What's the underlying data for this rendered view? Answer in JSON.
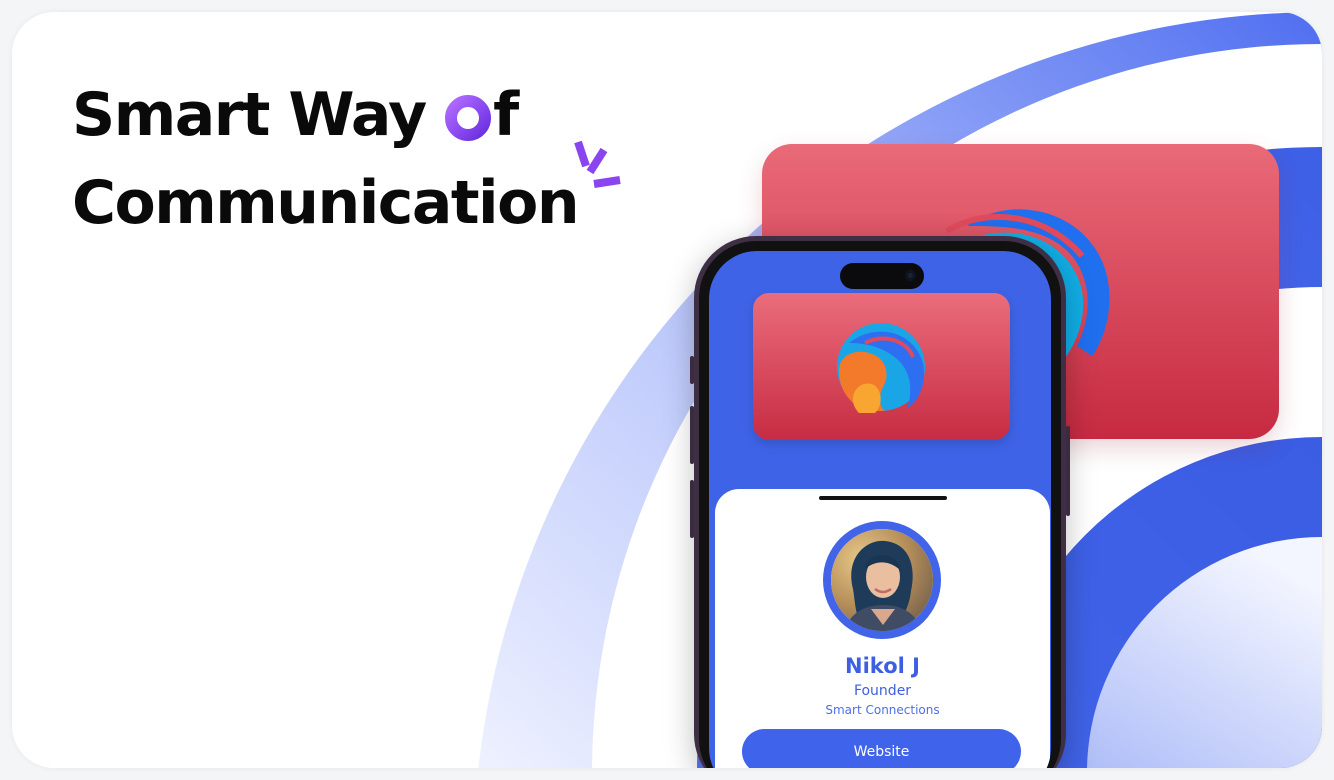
{
  "headline": {
    "line1_before": "Smart Way ",
    "line1_after": "f",
    "line2": "Communication"
  },
  "profile": {
    "name": "Nikol J",
    "role": "Founder",
    "company": "Smart Connections",
    "website_label": "Website"
  },
  "colors": {
    "brand_blue": "#3f63ea",
    "card_red_top": "#e96a78",
    "card_red_bottom": "#c62a41",
    "accent_purple": "#8b45ef"
  },
  "icons": {
    "o_letter": "purple-donut-icon",
    "sparkle": "sparkle-burst-icon",
    "logo": "swirl-logo-icon"
  }
}
